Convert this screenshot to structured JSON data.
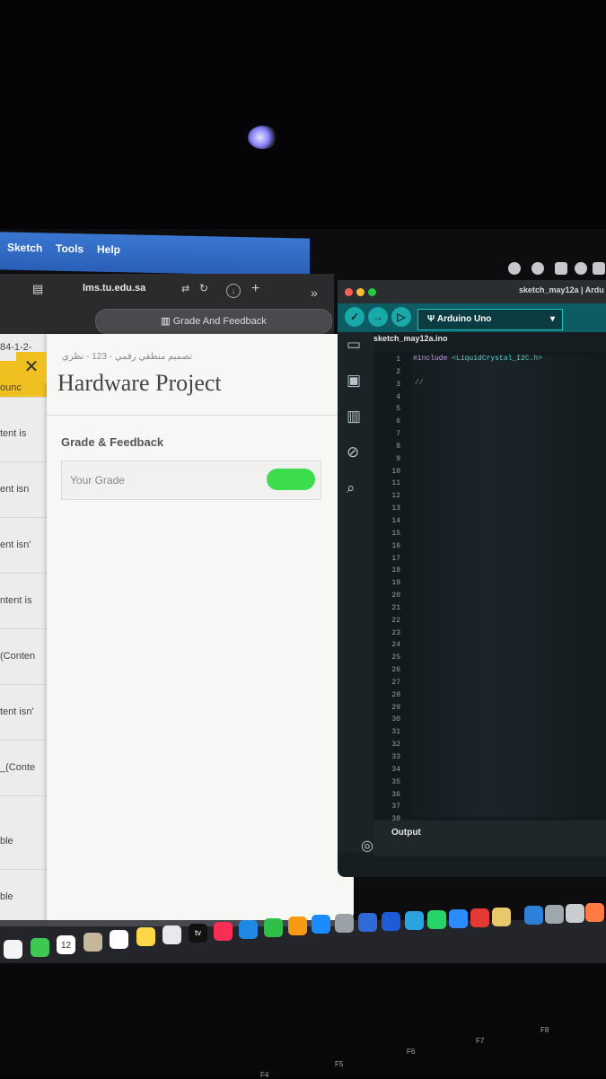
{
  "menubar": {
    "items": [
      "Sketch",
      "Tools",
      "Help"
    ]
  },
  "browser": {
    "address": "lms.tu.edu.sa",
    "tab_label": "Grade And Feedback",
    "sidebar_snippets": [
      "84-1-2-",
      "ounc",
      "tent is",
      "ent isn",
      "ent isn'",
      "ntent is",
      "(Conten",
      "tent isn'",
      "_(Conte",
      "ble",
      "ble"
    ],
    "panel": {
      "close": "✕",
      "course_arabic": "تصميم منطقي رقمي - 123 - نظري",
      "title": "Hardware Project",
      "section_title": "Grade & Feedback",
      "grade_label": "Your Grade"
    }
  },
  "arduino": {
    "window_title": "sketch_may12a | Ardu",
    "board": "Arduino Uno",
    "file_tab": "sketch_may12a.ino",
    "line_numbers": [
      "1",
      "2",
      "3",
      "4",
      "5",
      "6",
      "7",
      "8",
      "9",
      "10",
      "11",
      "12",
      "13",
      "14",
      "15",
      "16",
      "17",
      "18",
      "19",
      "20",
      "21",
      "22",
      "23",
      "24",
      "25",
      "26",
      "27",
      "28",
      "29",
      "30",
      "31",
      "32",
      "33",
      "34",
      "35",
      "36",
      "37",
      "38"
    ],
    "code_line_1": "#include <LiquidCrystal_I2C.h>",
    "code_line_3": "//",
    "output_label": "Output"
  },
  "dock": {
    "calendar_day": "12",
    "tv_label": "tv"
  },
  "keyboard": {
    "f_keys": [
      "F4",
      "F5",
      "F6",
      "F7",
      "F8"
    ]
  },
  "colors": {
    "grade_pill": "#3ddc4f",
    "arduino_teal": "#0d5b63",
    "include_purple": "#c792ea"
  }
}
